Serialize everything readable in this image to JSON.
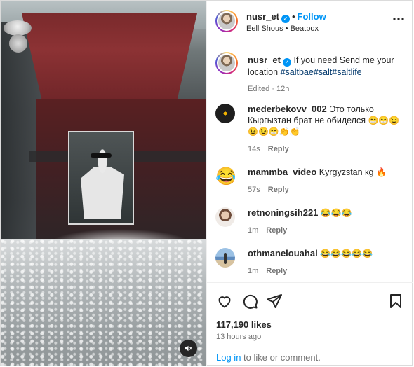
{
  "post": {
    "username": "nusr_et",
    "follow_label": "Follow",
    "audio": "Eell Shous",
    "audio_sep": "•",
    "audio_track": "Beatbox",
    "caption": "If you need Send me your location",
    "hashtags": "#saltbae#salt#saltlife",
    "edited": "Edited",
    "edited_sep": "·",
    "edited_time": "12h"
  },
  "comments": [
    {
      "username": "mederbekovv_002",
      "text": "Это только Кыргызтан брат не обиделся",
      "emoji": "😁😁😉 😉😉😁👏👏",
      "time": "14s",
      "reply": "Reply"
    },
    {
      "username": "mammba_video",
      "text": "Kyrgyzstan кg",
      "emoji": "🔥",
      "time": "57s",
      "reply": "Reply"
    },
    {
      "username": "retnoningsih221",
      "text": "",
      "emoji": "😂😂😂",
      "time": "1m",
      "reply": "Reply"
    },
    {
      "username": "othmanelouahal",
      "text": "",
      "emoji": "😂😂😂😂😂",
      "time": "1m",
      "reply": "Reply"
    }
  ],
  "footer": {
    "likes": "117,190 likes",
    "posted": "13 hours ago",
    "login_link": "Log in",
    "login_rest": "to like or comment."
  },
  "icons": {
    "mute": "speaker-muted-icon",
    "like": "heart-icon",
    "comment": "comment-bubble-icon",
    "share": "paper-plane-icon",
    "save": "bookmark-icon",
    "more": "more-dots-icon",
    "verified": "verified-badge-icon"
  },
  "colors": {
    "accent": "#0095f6",
    "hashtag": "#00376b",
    "muted": "#737373"
  }
}
